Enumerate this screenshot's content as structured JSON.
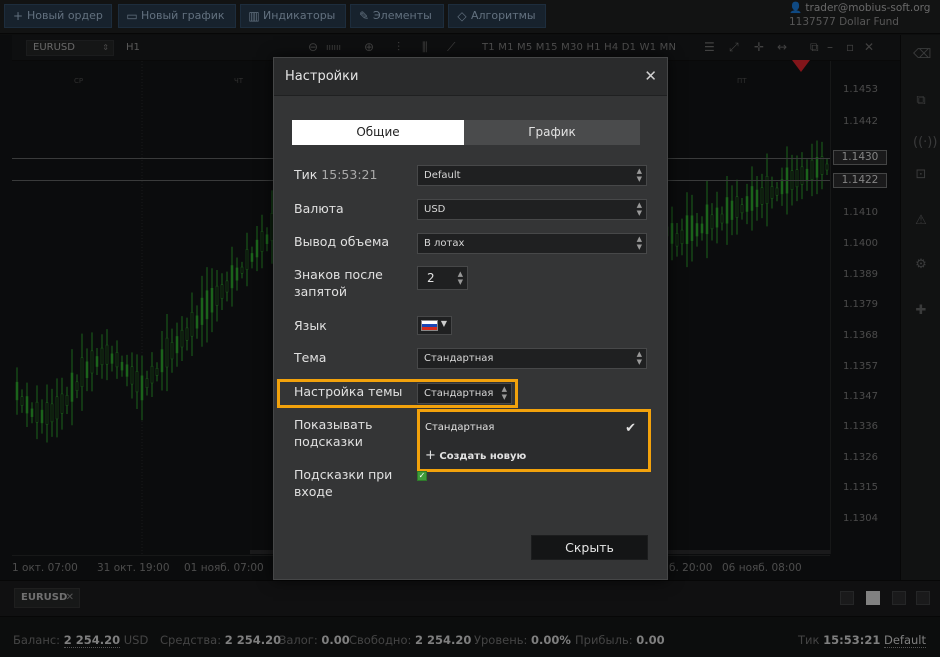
{
  "toolbar": {
    "buttons": [
      {
        "label": "Новый ордер",
        "icon": "plus-icon"
      },
      {
        "label": "Новый график",
        "icon": "chart-icon"
      },
      {
        "label": "Индикаторы",
        "icon": "bars-icon"
      },
      {
        "label": "Элементы",
        "icon": "pen-icon"
      },
      {
        "label": "Алгоритмы",
        "icon": "diamond-icon"
      }
    ],
    "user_email": "trader@mobius-soft.org",
    "account": "1137577 Dollar Fund"
  },
  "chart": {
    "symbol": "EURUSD",
    "timeframe": "H1",
    "timeframes": "T1 M1 M5 M15 M30 H1 H4 D1 W1 MN",
    "price_ticks": [
      "1.1453",
      "1.1442",
      "1.1410",
      "1.1400",
      "1.1389",
      "1.1379",
      "1.1368",
      "1.1357",
      "1.1347",
      "1.1336",
      "1.1326",
      "1.1315",
      "1.1304"
    ],
    "price_box_1": "1.1430",
    "price_box_2": "1.1422",
    "date_ticks": [
      "1 окт. 07:00",
      "31 окт. 19:00",
      "01 нояб. 07:00",
      "б. 20:00",
      "06 нояб. 08:00"
    ],
    "day_labels": [
      "СР",
      "ЧТ",
      "ПТ"
    ]
  },
  "colors": {
    "highlight": "#f2a20c",
    "candle_green": "#2ca02c",
    "marker_red": "#d2232a"
  },
  "tabs": {
    "symbol_tab": "EURUSD"
  },
  "status": {
    "balance_label": "Баланс:",
    "balance_value": "2 254.20",
    "balance_currency": "USD",
    "funds_label": "Средства:",
    "funds_value": "2 254.20",
    "margin_label": "Залог:",
    "margin_value": "0.00",
    "free_label": "Свободно:",
    "free_value": "2 254.20",
    "level_label": "Уровень:",
    "level_value": "0.00%",
    "profit_label": "Прибыль:",
    "profit_value": "0.00",
    "tick_label": "Тик",
    "tick_time": "15:53:21",
    "tick_mode": "Default"
  },
  "modal": {
    "title": "Настройки",
    "tab_general": "Общие",
    "tab_chart": "График",
    "tick_label": "Тик",
    "tick_time": "15:53:21",
    "tick_value": "Default",
    "currency_label": "Валюта",
    "currency_value": "USD",
    "volume_label": "Вывод объема",
    "volume_value": "В лотах",
    "decimals_label": "Знаков после запятой",
    "decimals_value": "2",
    "language_label": "Язык",
    "theme_label": "Тема",
    "theme_value": "Стандартная",
    "theme_setting_label": "Настройка темы",
    "theme_setting_value": "Стандартная",
    "dropdown_options": [
      "Стандартная",
      "Создать новую"
    ],
    "hints_label": "Показывать подсказки",
    "login_hints_label": "Подсказки при входе",
    "hide_button": "Скрыть"
  }
}
